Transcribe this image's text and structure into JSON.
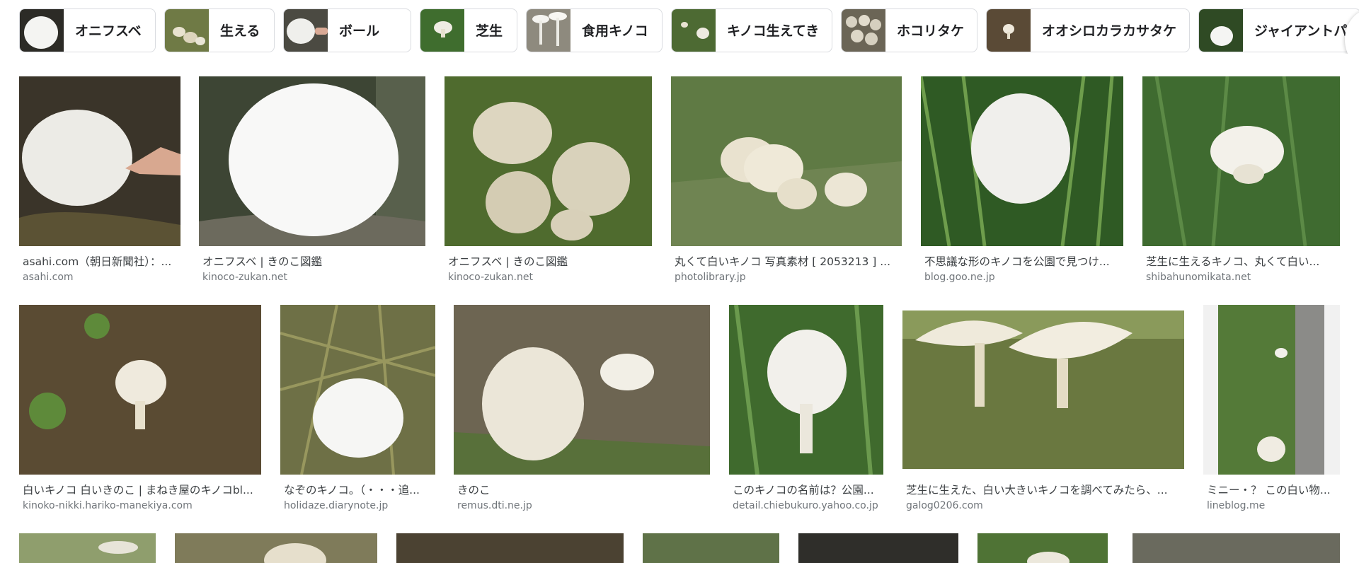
{
  "chips": [
    {
      "label": "オニフスベ",
      "thumb": "white-puffball-dark-icon"
    },
    {
      "label": "生える",
      "thumb": "small-mushrooms-grass-icon"
    },
    {
      "label": "ボール",
      "thumb": "ball-mushroom-hand-icon"
    },
    {
      "label": "芝生",
      "thumb": "mushroom-on-lawn-icon"
    },
    {
      "label": "食用キノコ",
      "thumb": "tall-white-mushrooms-icon"
    },
    {
      "label": "キノコ生えてき",
      "thumb": "mushroom-sprouting-icon"
    },
    {
      "label": "ホコリタケ",
      "thumb": "puffball-cluster-icon"
    },
    {
      "label": "オオシロカラカサタケ",
      "thumb": "parasol-mushroom-icon"
    },
    {
      "label": "ジャイアントパ",
      "thumb": "giant-puffball-icon"
    }
  ],
  "row1": [
    {
      "title": "asahi.com（朝日新聞社）：...",
      "source": "asahi.com"
    },
    {
      "title": "オニフスベ | きのこ図鑑",
      "source": "kinoco-zukan.net"
    },
    {
      "title": "オニフスベ | きのこ図鑑",
      "source": "kinoco-zukan.net"
    },
    {
      "title": "丸くて白いキノコ 写真素材 [ 2053213 ] ...",
      "source": "photolibrary.jp"
    },
    {
      "title": "不思議な形のキノコを公園で見つけ...",
      "source": "blog.goo.ne.jp"
    },
    {
      "title": "芝生に生えるキノコ、丸くて白い...",
      "source": "shibahunomikata.net"
    }
  ],
  "row2": [
    {
      "title": "白いキノコ 白いきのこ | まねき屋のキノコbl...",
      "source": "kinoko-nikki.hariko-manekiya.com"
    },
    {
      "title": "なぞのキノコ。（・・・追...",
      "source": "holidaze.diarynote.jp"
    },
    {
      "title": "きのこ",
      "source": "remus.dti.ne.jp"
    },
    {
      "title": "このキノコの名前は？公園...",
      "source": "detail.chiebukuro.yahoo.co.jp"
    },
    {
      "title": "芝生に生えた、白い大きいキノコを調べてみたら、...",
      "source": "galog0206.com"
    },
    {
      "title": "ミニー・？ この白い物...",
      "source": "lineblog.me"
    }
  ],
  "icons": {
    "next": "chevron-right-icon"
  },
  "colors": {
    "chip_border": "#dadce0",
    "title": "#3c4043",
    "source": "#70757a"
  }
}
